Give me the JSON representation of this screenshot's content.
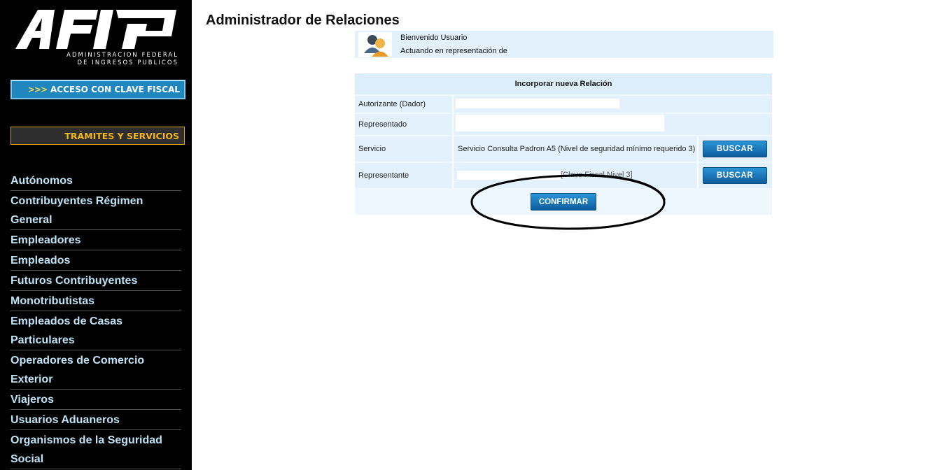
{
  "sidebar": {
    "logo": {
      "word": "AFIP",
      "line1": "ADMINISTRACION FEDERAL",
      "line2": "DE INGRESOS PUBLICOS"
    },
    "clave_button": {
      "arrows": ">>>",
      "label": "ACCESO CON CLAVE FISCAL"
    },
    "tramites_button": {
      "label": "TRÁMITES Y SERVICIOS"
    },
    "nav": [
      "Autónomos",
      "Contribuyentes Régimen General",
      "Empleadores",
      "Empleados",
      "Futuros Contribuyentes",
      "Monotributistas",
      "Empleados de Casas Particulares",
      "Operadores de Comercio Exterior",
      "Viajeros",
      "Usuarios Aduaneros",
      "Organismos de la Seguridad Social"
    ]
  },
  "main": {
    "title": "Administrador de Relaciones",
    "welcome": {
      "line1": "Bienvenido Usuario",
      "line2": "Actuando en representación de"
    },
    "form": {
      "header": "Incorporar nueva Relación",
      "autorizante_label": "Autorizante (Dador)",
      "representado_label": "Representado",
      "servicio_label": "Servicio",
      "servicio_value": "Servicio Consulta Padron A5 (Nivel de seguridad mínimo requerido 3)",
      "representante_label": "Representante",
      "representante_note": "[Clave Fiscal Nivel 3]",
      "buscar_label": "BUSCAR",
      "confirm_label": "CONFIRMAR"
    }
  },
  "colors": {
    "sidebar_bg": "#000000",
    "nav_text": "#bfe3f6",
    "clave_bg": "#1f86c0",
    "tramites_text": "#f5b617",
    "button_blue": "#1577bb",
    "panel_bg": "#e2f1fb"
  },
  "icons": {
    "avatar": "users-icon",
    "logo": "afip-logo-icon"
  }
}
